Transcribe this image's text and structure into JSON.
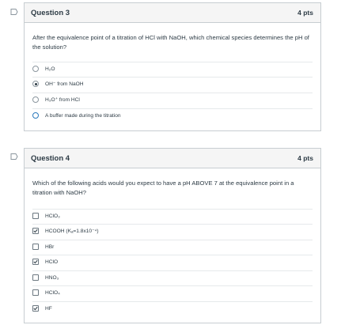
{
  "question3": {
    "title": "Question 3",
    "points": "4 pts",
    "text": "After the equivalence point of a titration of HCl with NaOH, which chemical species determines the pH of the solution?",
    "answers": [
      {
        "label": "H₂O",
        "selected": false
      },
      {
        "label": "OH⁻ from NaOH",
        "selected": true
      },
      {
        "label": "H₃O⁺ from HCl",
        "selected": false
      },
      {
        "label": "A buffer made during the titration",
        "selected": false
      }
    ]
  },
  "question4": {
    "title": "Question 4",
    "points": "4 pts",
    "text": "Which of the following acids would you expect to have a pH ABOVE 7 at the equivalence point in a titration with NaOH?",
    "answers": [
      {
        "label": "HClO₃",
        "checked": false
      },
      {
        "label": "HCOOH (Kₐ=1.8x10⁻⁴)",
        "checked": true
      },
      {
        "label": "HBr",
        "checked": false
      },
      {
        "label": "HClO",
        "checked": true
      },
      {
        "label": "HNO₃",
        "checked": false
      },
      {
        "label": "HClO₄",
        "checked": false
      },
      {
        "label": "HF",
        "checked": true
      }
    ]
  },
  "colors": {
    "border": "#c7cdd1",
    "header_bg": "#f5f5f5",
    "text": "#2d3b45",
    "focus_blue": "#2b7abc"
  }
}
